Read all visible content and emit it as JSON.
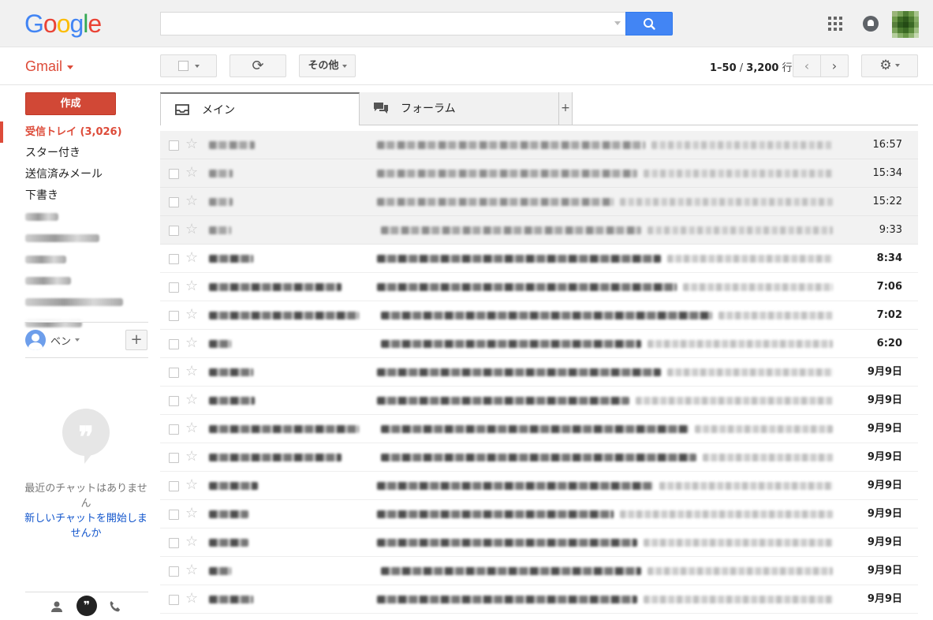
{
  "header": {
    "logo_letters": [
      {
        "char": "G",
        "color": "#4285f4"
      },
      {
        "char": "o",
        "color": "#ea4335"
      },
      {
        "char": "o",
        "color": "#fbbc05"
      },
      {
        "char": "g",
        "color": "#4285f4"
      },
      {
        "char": "l",
        "color": "#34a853"
      },
      {
        "char": "e",
        "color": "#ea4335"
      }
    ],
    "search": {
      "value": "",
      "placeholder": "",
      "button_icon": "search-icon"
    },
    "icons": {
      "apps": "apps-grid-icon",
      "notifications": "bell-icon",
      "account": "account-avatar-icon"
    }
  },
  "toolbar": {
    "app_menu_label": "Gmail",
    "more_label": "その他",
    "refresh_icon": "⟳",
    "pagination": {
      "range": "1–50",
      "separator": " / ",
      "total": "3,200",
      "unit": " 行"
    },
    "prev_icon": "‹",
    "next_icon": "›",
    "settings_icon": "⚙"
  },
  "sidebar": {
    "compose_label": "作成",
    "items": [
      {
        "label": "受信トレイ (3,026)",
        "active": true
      },
      {
        "label": "スター付き"
      },
      {
        "label": "送信済みメール"
      },
      {
        "label": "下書き"
      }
    ],
    "blurred_label_count": 6,
    "chat": {
      "user_name": "ベン",
      "add_label": "+",
      "empty_text": "最近のチャットはありません",
      "start_link": "新しいチャットを開始しませんか",
      "tabs": {
        "people": "👤",
        "hangouts": "❞",
        "phone": "☎"
      }
    }
  },
  "tabs": [
    {
      "label": "メイン",
      "icon": "inbox-icon",
      "selected": true
    },
    {
      "label": "フォーラム",
      "icon": "forum-icon",
      "selected": false
    }
  ],
  "tab_add_label": "+",
  "messages": [
    {
      "date": "16:57",
      "read": true
    },
    {
      "date": "15:34",
      "read": true
    },
    {
      "date": "15:22",
      "read": true
    },
    {
      "date": "9:33",
      "read": true
    },
    {
      "date": "8:34",
      "read": false
    },
    {
      "date": "7:06",
      "read": false
    },
    {
      "date": "7:02",
      "read": false
    },
    {
      "date": "6:20",
      "read": false
    },
    {
      "date": "9月9日",
      "read": false
    },
    {
      "date": "9月9日",
      "read": false
    },
    {
      "date": "9月9日",
      "read": false
    },
    {
      "date": "9月9日",
      "read": false
    },
    {
      "date": "9月9日",
      "read": false
    },
    {
      "date": "9月9日",
      "read": false
    },
    {
      "date": "9月9日",
      "read": false
    },
    {
      "date": "9月9日",
      "read": false
    },
    {
      "date": "9月9日",
      "read": false
    }
  ],
  "colors": {
    "accent": "#dd4b39",
    "compose": "#d14836",
    "search_button": "#4285f4",
    "link": "#1155cc"
  }
}
